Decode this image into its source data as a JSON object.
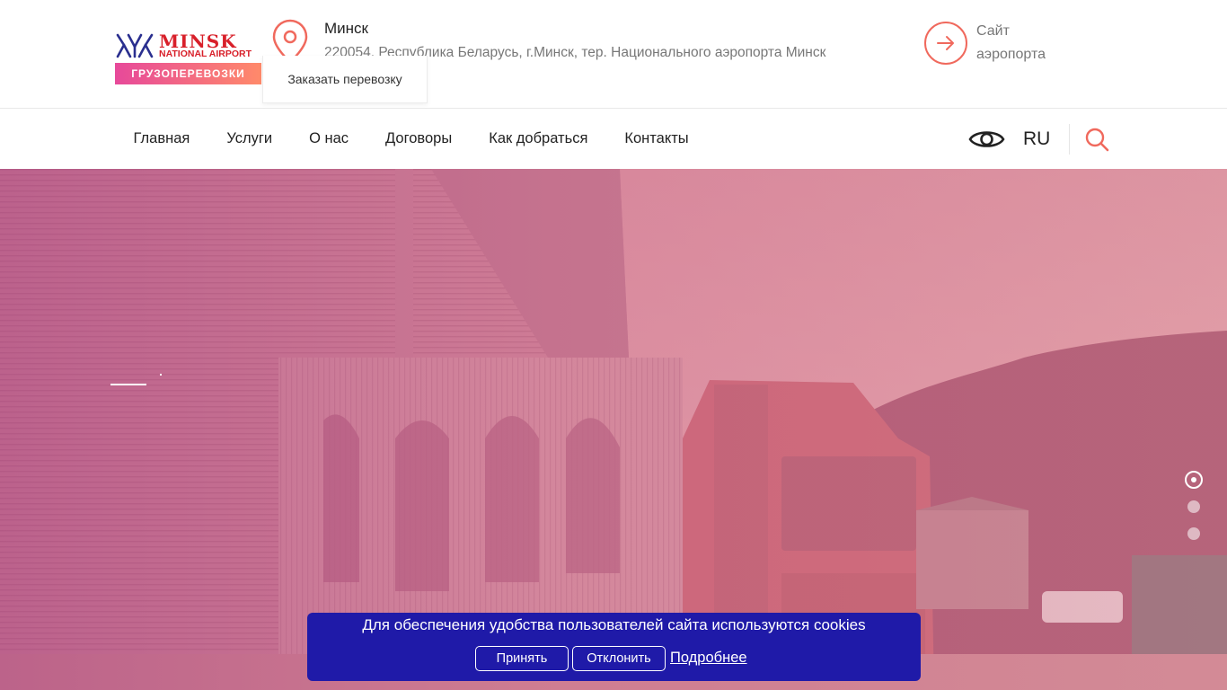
{
  "header": {
    "logo": {
      "title": "MINSK",
      "subtitle": "NATIONAL AIRPORT",
      "badge": "ГРУЗОПЕРЕВОЗКИ"
    },
    "location": {
      "city": "Минск",
      "address": "220054, Республика Беларусь, г.Минск, тер. Национального аэропорта Минск"
    },
    "order_label": "Заказать перевозку",
    "site_link_label": "Сайт аэропорта"
  },
  "nav": {
    "items": [
      {
        "label": "Главная"
      },
      {
        "label": "Услуги"
      },
      {
        "label": "О нас"
      },
      {
        "label": "Договоры"
      },
      {
        "label": "Как добраться"
      },
      {
        "label": "Контакты"
      }
    ],
    "language": "RU",
    "icons": [
      "eye-icon",
      "search-icon"
    ]
  },
  "hero": {
    "slides_count": 3,
    "active_slide": 1
  },
  "cookie": {
    "message": "Для обеспечения удобства пользователей сайта используются cookies",
    "accept_label": "Принять",
    "decline_label": "Отклонить",
    "more_label": "Подробнее"
  },
  "colors": {
    "brand_red": "#d8202a",
    "accent_coral": "#f0695d",
    "badge_gradient_start": "#e7499a",
    "badge_gradient_end": "#ff8a6a",
    "cookie_bg": "#1f1aa8"
  }
}
